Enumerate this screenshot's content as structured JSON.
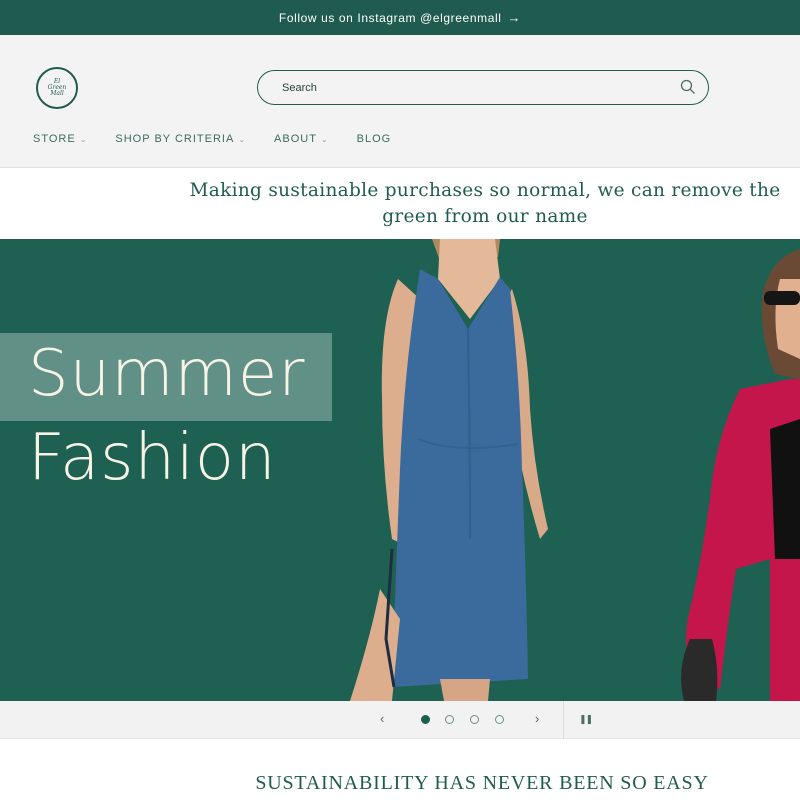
{
  "announcement": {
    "text": "Follow us on Instagram @elgreenmall",
    "arrow": "→"
  },
  "logo": {
    "line1": "El",
    "line2": "Green",
    "line3": "Mall"
  },
  "search": {
    "placeholder": "Search"
  },
  "nav": {
    "items": [
      {
        "label": "STORE",
        "has_dropdown": true
      },
      {
        "label": "SHOP BY CRITERIA",
        "has_dropdown": true
      },
      {
        "label": "ABOUT",
        "has_dropdown": true
      },
      {
        "label": "BLOG",
        "has_dropdown": false
      }
    ]
  },
  "tagline": "Making sustainable purchases so normal, we can remove the green from our name",
  "hero": {
    "title_line1": "Summer",
    "title_line2": "Fashion",
    "background_color": "#1e6152",
    "images": [
      "woman-in-blue-slip-dress",
      "woman-in-red-blazer-and-sunglasses"
    ]
  },
  "slider": {
    "prev_label": "‹",
    "next_label": "›",
    "pause_label": "❚❚",
    "slides": 4,
    "active_index": 0
  },
  "section_heading": "SUSTAINABILITY HAS NEVER BEEN SO EASY",
  "colors": {
    "brand": "#1f5c4f",
    "header_bg": "#f3f3f3",
    "hero_text": "#f7f3e6",
    "accent_red": "#c4164a",
    "dress_blue": "#3b6b9c"
  }
}
